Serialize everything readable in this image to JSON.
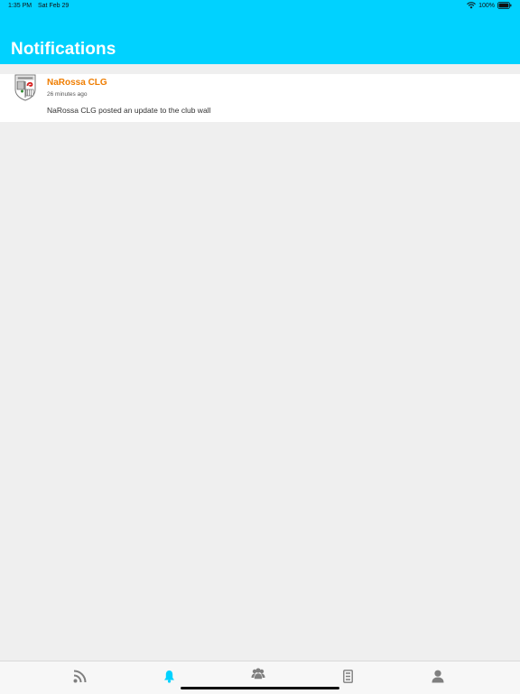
{
  "status_bar": {
    "time": "1:35 PM",
    "date": "Sat Feb 29",
    "battery": "100%"
  },
  "header": {
    "title": "Notifications"
  },
  "notifications": [
    {
      "sender": "NaRossa CLG",
      "time": "26 minutes ago",
      "message": "NaRossa CLG posted an update to the club wall",
      "icon": "club-crest-icon"
    }
  ],
  "tab_bar": {
    "active": "notifications",
    "tabs": [
      {
        "id": "feed",
        "icon": "rss-icon"
      },
      {
        "id": "notifications",
        "icon": "bell-icon"
      },
      {
        "id": "groups",
        "icon": "group-icon"
      },
      {
        "id": "club",
        "icon": "list-icon"
      },
      {
        "id": "profile",
        "icon": "user-icon"
      }
    ]
  },
  "colors": {
    "header": "#00d2ff",
    "sender": "#ef7d00",
    "active_tab": "#00d2ff",
    "inactive_tab": "#7f7f7f",
    "background": "#efefef"
  }
}
